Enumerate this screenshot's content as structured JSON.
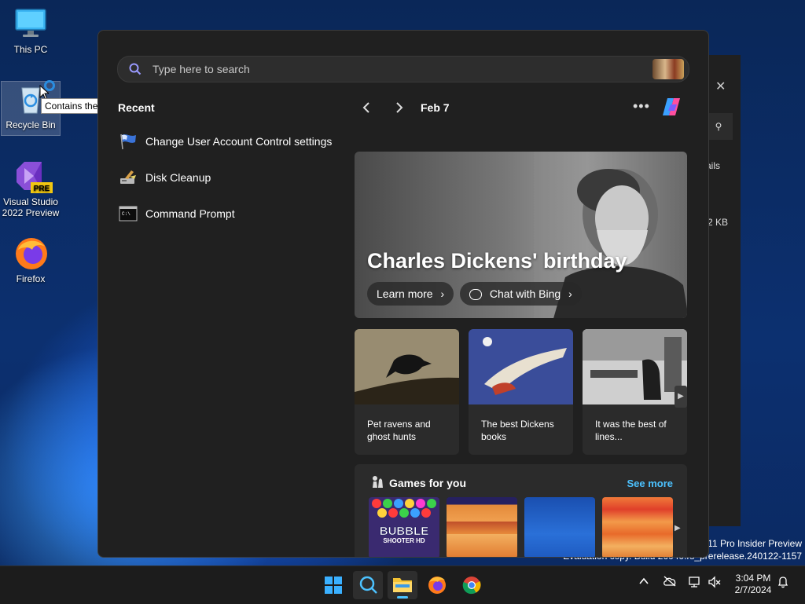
{
  "desktop": {
    "icons": [
      {
        "label": "This PC"
      },
      {
        "label": "Recycle Bin"
      },
      {
        "label_line1": "Visual Studio",
        "label_line2": "2022 Preview",
        "badge": "PRE"
      },
      {
        "label": "Firefox"
      }
    ],
    "tooltip": "Contains the"
  },
  "background_window": {
    "partial_text_1": "ails",
    "partial_text_2": "2 KB"
  },
  "watermark": {
    "line1": "11 Pro Insider Preview",
    "line2": "Evaluation copy. Build 26040.rs_prerelease.240122-1157"
  },
  "search": {
    "placeholder": "Type here to search"
  },
  "recent": {
    "title": "Recent",
    "items": [
      {
        "label": "Change User Account Control settings",
        "icon": "uac-flag-icon"
      },
      {
        "label": "Disk Cleanup",
        "icon": "disk-cleanup-icon"
      },
      {
        "label": "Command Prompt",
        "icon": "command-prompt-icon"
      }
    ]
  },
  "widgets": {
    "date": "Feb 7",
    "more": "•••",
    "hero": {
      "title": "Charles Dickens' birthday",
      "learn_more": "Learn more",
      "chat_with_bing": "Chat with Bing"
    },
    "cards": [
      {
        "text": "Pet ravens and ghost hunts"
      },
      {
        "text": "The best Dickens books"
      },
      {
        "text": "It was the best of lines..."
      }
    ],
    "games": {
      "title": "Games for you",
      "see_more": "See more",
      "tiles": [
        {
          "label_line1": "BUBBLE",
          "label_line2": "SHOOTER HD"
        },
        {
          "label": ""
        },
        {
          "label": ""
        },
        {
          "label": ""
        }
      ]
    }
  },
  "taskbar": {
    "apps": [
      "start-button",
      "search-button",
      "file-explorer",
      "firefox",
      "chrome"
    ],
    "clock": {
      "time": "3:04 PM",
      "date": "2/7/2024"
    }
  },
  "colors": {
    "panel_bg": "#202020",
    "accent": "#4cc2ff",
    "taskbar_bg": "#1c1c1c"
  }
}
